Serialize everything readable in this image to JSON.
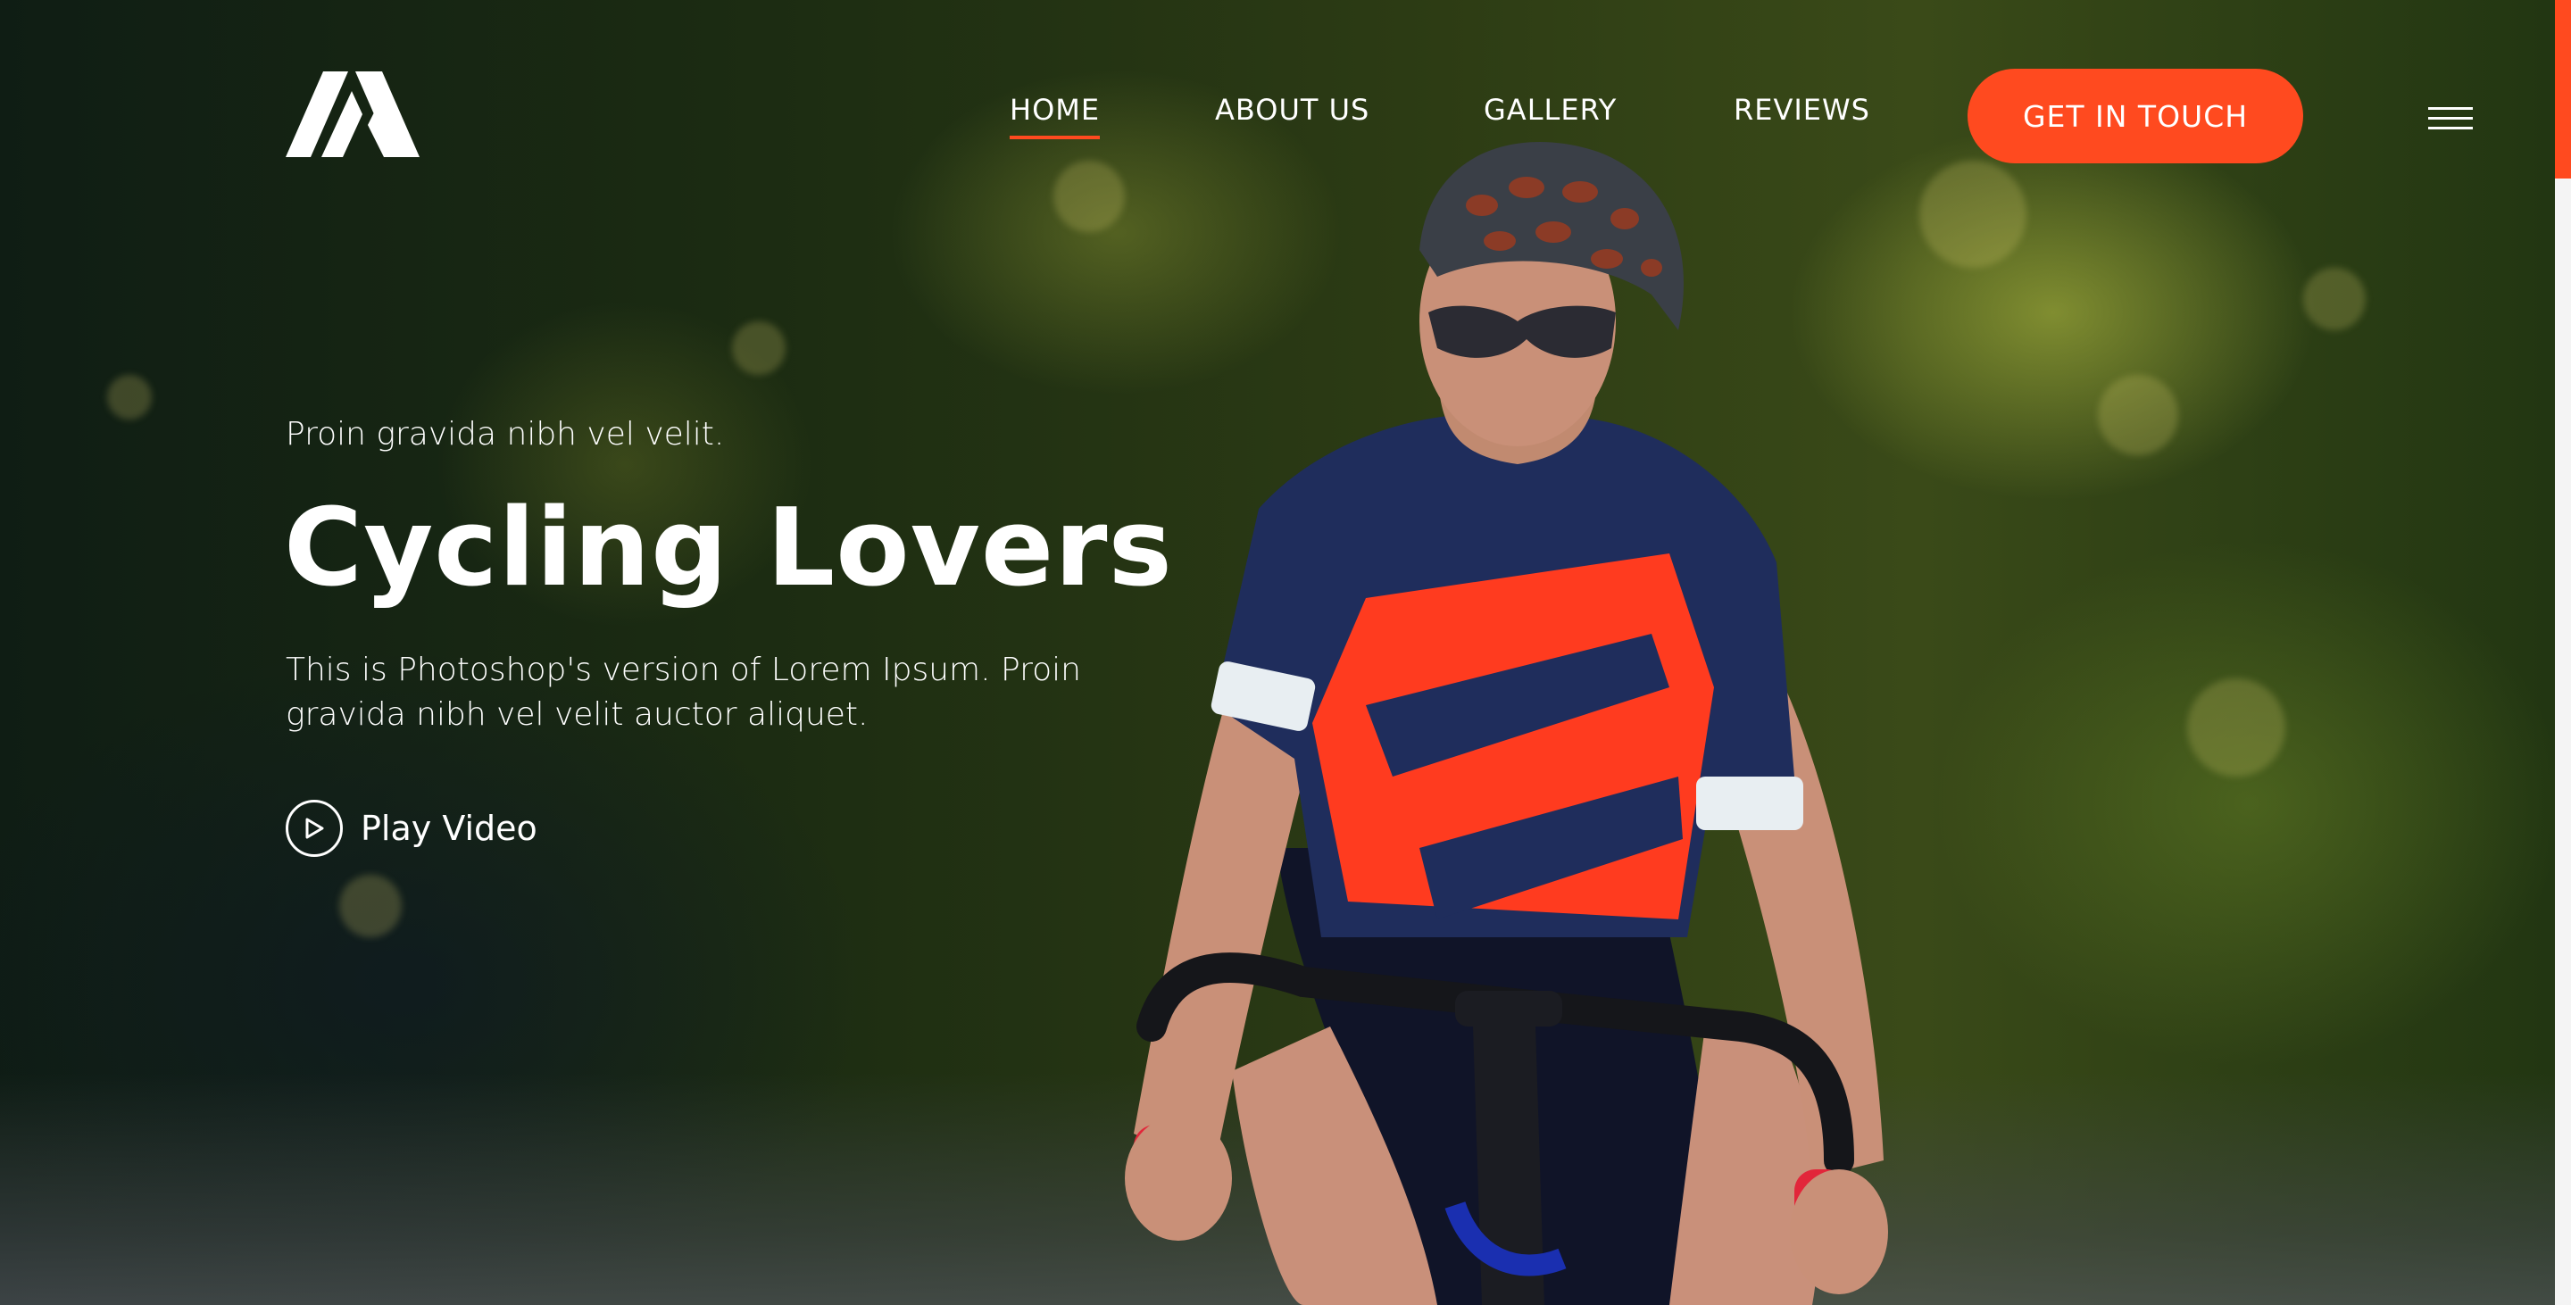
{
  "brand": {
    "logo_icon": "mountain-logo-icon"
  },
  "nav": {
    "items": [
      {
        "label": "HOME",
        "active": true
      },
      {
        "label": "ABOUT US",
        "active": false
      },
      {
        "label": "GALLERY",
        "active": false
      },
      {
        "label": "REVIEWS",
        "active": false
      }
    ],
    "cta_label": "GET IN TOUCH",
    "menu_icon": "hamburger-menu-icon"
  },
  "hero": {
    "kicker": "Proin gravida nibh vel velit.",
    "title": "Cycling Lovers",
    "description": "This is Photoshop's version of Lorem Ipsum. Proin gravida nibh vel velit auctor aliquet.",
    "play_label": "Play Video",
    "play_icon": "play-icon"
  },
  "colors": {
    "accent": "#ff4a1f",
    "text": "#ffffff",
    "jersey_navy": "#1f2d5c",
    "jersey_red": "#ff3b1f"
  }
}
